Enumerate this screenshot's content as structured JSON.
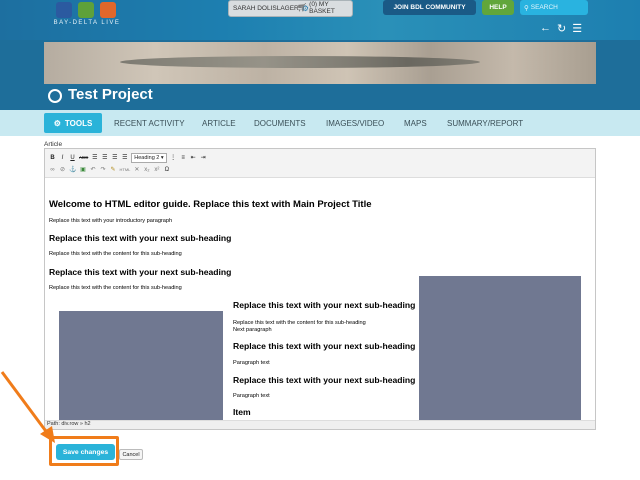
{
  "header": {
    "logo_text": "BAY-DELTA LIVE",
    "user_name": "SARAH DOLISLAGER",
    "basket_label": "(0) MY BASKET",
    "community_label": "JOIN BDL COMMUNITY",
    "help_label": "HELP",
    "search_placeholder": "SEARCH"
  },
  "project": {
    "title": "Test Project"
  },
  "tabs": {
    "tools": "TOOLS",
    "items": [
      "RECENT ACTIVITY",
      "ARTICLE",
      "DOCUMENTS",
      "IMAGES/VIDEO",
      "MAPS",
      "SUMMARY/REPORT"
    ]
  },
  "editor": {
    "label": "Article",
    "format_select": "Heading 2",
    "heading_main": "Welcome to HTML editor guide. Replace this text with Main Project Title",
    "intro_paragraph": "Replace this text with your introductory paragraph",
    "sub_heading": "Replace this text with your next sub-heading",
    "sub_content": "Replace this text with the content for this sub-heading",
    "next_paragraph": "Next paragraph",
    "paragraph_text": "Paragraph text",
    "item_heading": "Item",
    "path": "Path: div.row » h2"
  },
  "actions": {
    "save_label": "Save changes",
    "cancel_label": "Cancel"
  },
  "colors": {
    "header_blue": "#1d6fa0",
    "tab_bar": "#c8e9f1",
    "accent_cyan": "#2ab3d9",
    "help_green": "#61a63b",
    "highlight_orange": "#f07c1a",
    "image_placeholder": "#707891"
  }
}
